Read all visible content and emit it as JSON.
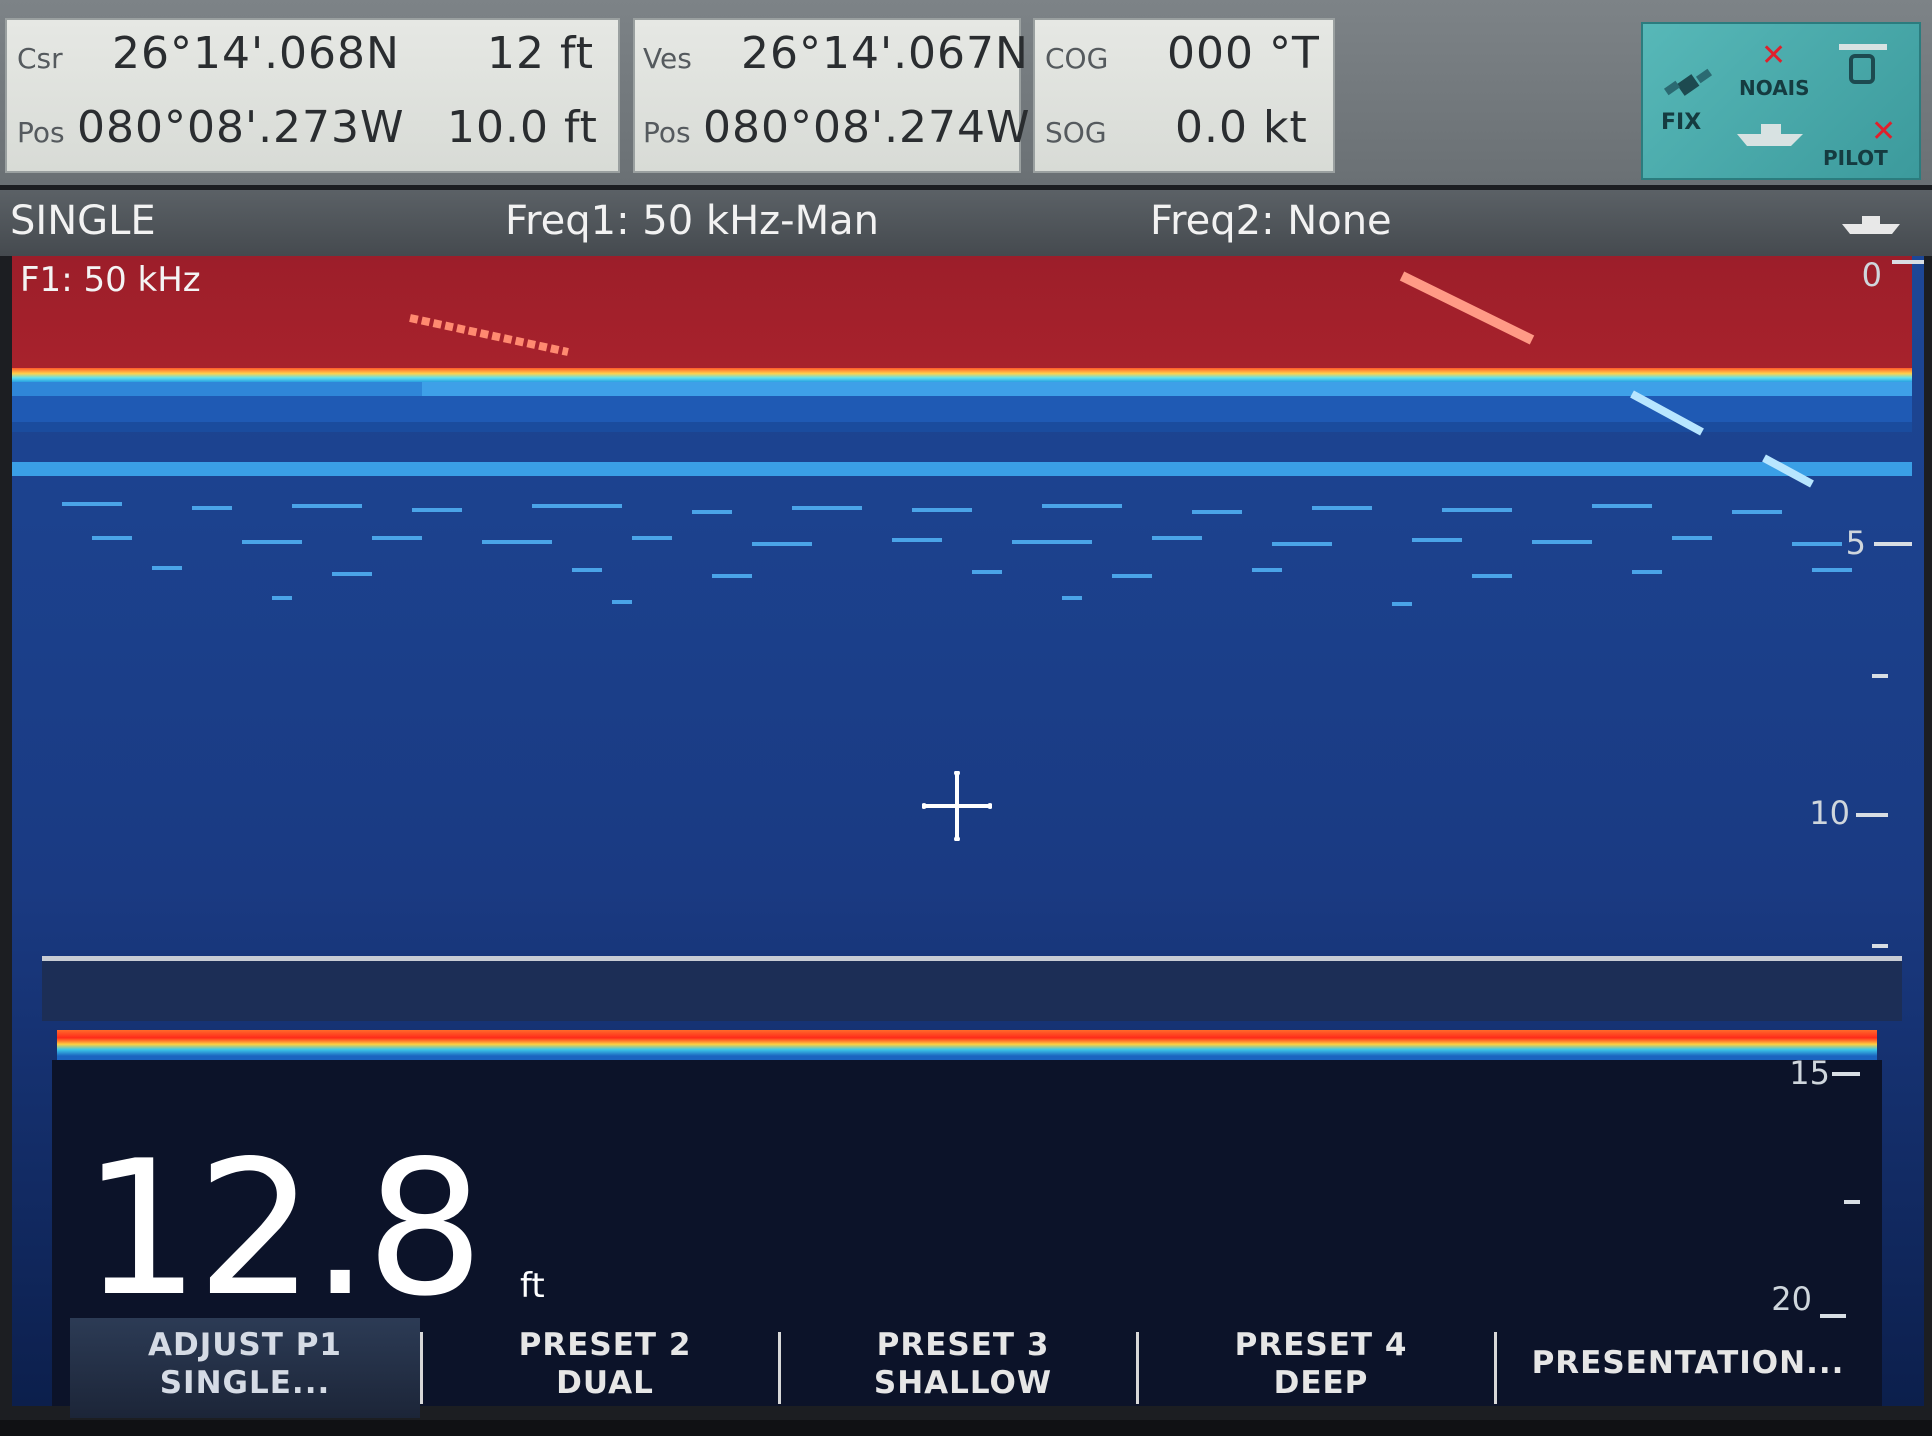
{
  "databar": {
    "cursor": {
      "label": "Csr",
      "lat": "26°14'.068N",
      "range": "12 ft",
      "pos_label": "Pos",
      "lon": "080°08'.273W",
      "depth": "10.0 ft"
    },
    "vessel": {
      "label": "Ves",
      "lat": "26°14'.067N",
      "pos_label": "Pos",
      "lon": "080°08'.274W"
    },
    "course": {
      "cog_label": "COG",
      "cog_value": "000 °T",
      "sog_label": "SOG",
      "sog_value": "0.0 kt"
    },
    "status": {
      "fix_label": "FIX",
      "ais_label": "NOAIS",
      "pilot_label": "PILOT",
      "icons": [
        "gps-satellite-icon",
        "ais-no-target-icon",
        "tank-icon",
        "boat-icon",
        "autopilot-off-icon"
      ]
    }
  },
  "modebar": {
    "mode": "SINGLE",
    "freq1": "Freq1: 50 kHz-Man",
    "freq2": "Freq2: None"
  },
  "sonar": {
    "channel_label": "F1: 50 kHz",
    "scale_labels": [
      "0",
      "5",
      "10",
      "15",
      "20"
    ],
    "depth_value": "12.8",
    "depth_unit": "ft",
    "colors": {
      "surface_clutter": "#a8202a",
      "water_column": "#1a3e86",
      "bottom_return": "#ff3a1a"
    }
  },
  "softkeys": [
    {
      "line1": "ADJUST P1",
      "line2": "SINGLE...",
      "active": true
    },
    {
      "line1": "PRESET 2",
      "line2": "DUAL",
      "active": false
    },
    {
      "line1": "PRESET 3",
      "line2": "SHALLOW",
      "active": false
    },
    {
      "line1": "PRESET 4",
      "line2": "DEEP",
      "active": false
    },
    {
      "line1": "PRESENTATION...",
      "line2": "",
      "active": false
    }
  ]
}
